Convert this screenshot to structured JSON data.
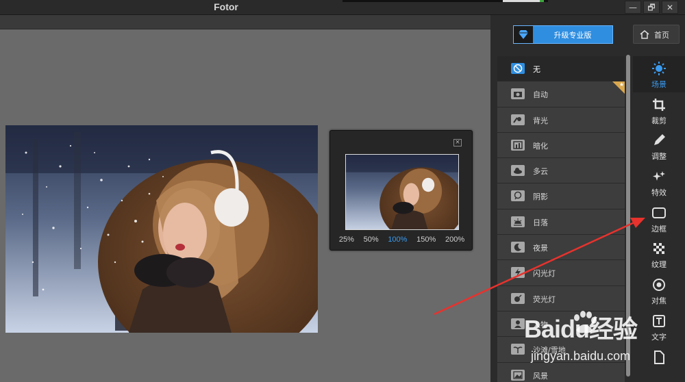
{
  "window": {
    "title": "Fotor"
  },
  "window_controls": [
    "—",
    "🗗",
    "✕"
  ],
  "panel": {
    "upgrade_label": "升级专业版",
    "home_label": "首页"
  },
  "effects": [
    {
      "label": "无",
      "icon": "no-icon",
      "selected": true
    },
    {
      "label": "自动",
      "icon": "camera-icon"
    },
    {
      "label": "背光",
      "icon": "backlight-icon"
    },
    {
      "label": "暗化",
      "icon": "darken-icon"
    },
    {
      "label": "多云",
      "icon": "cloud-icon"
    },
    {
      "label": "阴影",
      "icon": "shadow-icon"
    },
    {
      "label": "日落",
      "icon": "sunset-icon"
    },
    {
      "label": "夜景",
      "icon": "moon-icon"
    },
    {
      "label": "闪光灯",
      "icon": "flash-icon"
    },
    {
      "label": "荧光灯",
      "icon": "fluorescent-icon"
    },
    {
      "label": "人物",
      "icon": "person-icon"
    },
    {
      "label": "沙滩/雪地",
      "icon": "beach-icon"
    },
    {
      "label": "风景",
      "icon": "landscape-icon"
    }
  ],
  "tools": [
    {
      "label": "场景",
      "icon": "scene-icon",
      "active": true
    },
    {
      "label": "裁剪",
      "icon": "crop-icon"
    },
    {
      "label": "调整",
      "icon": "pencil-icon"
    },
    {
      "label": "特效",
      "icon": "sparkle-icon"
    },
    {
      "label": "边框",
      "icon": "frame-icon"
    },
    {
      "label": "纹理",
      "icon": "texture-icon"
    },
    {
      "label": "对焦",
      "icon": "focus-icon"
    },
    {
      "label": "文字",
      "icon": "text-icon"
    },
    {
      "label": "",
      "icon": "document-icon"
    }
  ],
  "navigator": {
    "zoom_levels": [
      "25%",
      "50%",
      "100%",
      "150%",
      "200%"
    ],
    "active_zoom": "100%",
    "close_glyph": "×"
  },
  "watermark": {
    "logo": "Baidu经验",
    "url": "jingyan.baidu.com"
  },
  "colors": {
    "accent": "#2f8ee0",
    "active_text": "#3a9bf0",
    "annotation_arrow": "#e8322d"
  }
}
